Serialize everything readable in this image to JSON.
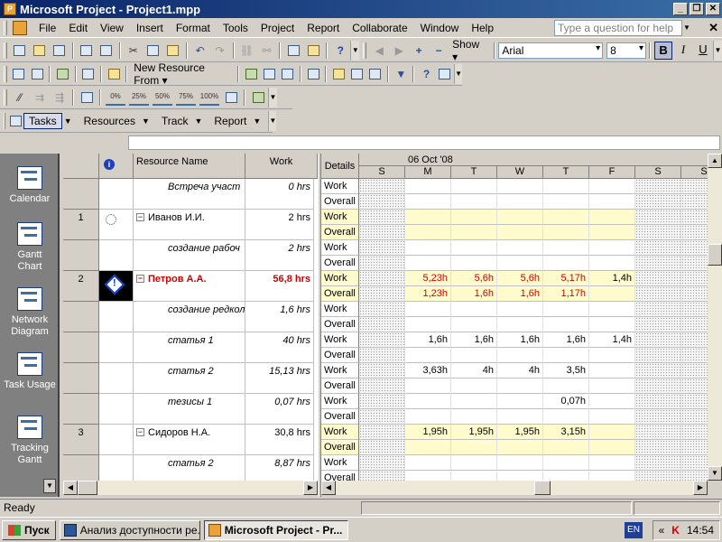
{
  "window": {
    "title": "Microsoft Project - Project1.mpp"
  },
  "menu": {
    "items": [
      "File",
      "Edit",
      "View",
      "Insert",
      "Format",
      "Tools",
      "Project",
      "Report",
      "Collaborate",
      "Window",
      "Help"
    ],
    "help_placeholder": "Type a question for help"
  },
  "toolbar_standard": {
    "show_label": "Show",
    "font": "Arial",
    "font_size": "8",
    "bold": "B",
    "italic": "I",
    "underline": "U"
  },
  "toolbar_resource": {
    "new_resource_from": "New Resource From"
  },
  "toolbar_tracking": {
    "percents": [
      "0%",
      "25%",
      "50%",
      "75%",
      "100%"
    ]
  },
  "toolbar_guide": {
    "tabs": [
      "Tasks",
      "Resources",
      "Track",
      "Report"
    ]
  },
  "viewbar": {
    "items": [
      {
        "label1": "Calendar",
        "label2": ""
      },
      {
        "label1": "Gantt",
        "label2": "Chart"
      },
      {
        "label1": "Network",
        "label2": "Diagram"
      },
      {
        "label1": "Task Usage",
        "label2": ""
      },
      {
        "label1": "Tracking",
        "label2": "Gantt"
      }
    ]
  },
  "grid": {
    "columns": {
      "indicator": "i",
      "name": "Resource Name",
      "work": "Work"
    },
    "rows": [
      {
        "id": "",
        "name": "Встреча участ",
        "work": "0 hrs",
        "type": "assignment"
      },
      {
        "id": "1",
        "name": "Иванов И.И.",
        "work": "2 hrs",
        "type": "resource"
      },
      {
        "id": "",
        "name": "создание рабоч",
        "work": "2 hrs",
        "type": "assignment"
      },
      {
        "id": "2",
        "name": "Петров А.А.",
        "work": "56,8 hrs",
        "type": "overalloc"
      },
      {
        "id": "",
        "name": "создание редкол",
        "work": "1,6 hrs",
        "type": "assignment"
      },
      {
        "id": "",
        "name": "статья 1",
        "work": "40 hrs",
        "type": "assignment"
      },
      {
        "id": "",
        "name": "статья 2",
        "work": "15,13 hrs",
        "type": "assignment"
      },
      {
        "id": "",
        "name": "тезисы 1",
        "work": "0,07 hrs",
        "type": "assignment"
      },
      {
        "id": "3",
        "name": "Сидоров Н.А.",
        "work": "30,8 hrs",
        "type": "resource"
      },
      {
        "id": "",
        "name": "статья 2",
        "work": "8,87 hrs",
        "type": "assignment"
      }
    ]
  },
  "usage": {
    "details_label": "Details",
    "week": "06 Oct '08",
    "days": [
      "S",
      "M",
      "T",
      "W",
      "T",
      "F",
      "S",
      "S"
    ],
    "work_label": "Work",
    "overall_label": "Overall",
    "rows": [
      {
        "work": [
          "",
          "",
          "",
          "",
          "",
          "",
          "",
          ""
        ],
        "overall": [
          "",
          "",
          "",
          "",
          "",
          "",
          "",
          ""
        ],
        "hl": false,
        "red": false
      },
      {
        "work": [
          "",
          "",
          "",
          "",
          "",
          "",
          "",
          ""
        ],
        "overall": [
          "",
          "",
          "",
          "",
          "",
          "",
          "",
          ""
        ],
        "hl": true,
        "red": false
      },
      {
        "work": [
          "",
          "",
          "",
          "",
          "",
          "",
          "",
          ""
        ],
        "overall": [
          "",
          "",
          "",
          "",
          "",
          "",
          "",
          ""
        ],
        "hl": false,
        "red": false
      },
      {
        "work": [
          "",
          "5,23h",
          "5,6h",
          "5,6h",
          "5,17h",
          "1,4h",
          "",
          ""
        ],
        "overall": [
          "",
          "1,23h",
          "1,6h",
          "1,6h",
          "1,17h",
          "",
          "",
          ""
        ],
        "hl": true,
        "red": true
      },
      {
        "work": [
          "",
          "",
          "",
          "",
          "",
          "",
          "",
          ""
        ],
        "overall": [
          "",
          "",
          "",
          "",
          "",
          "",
          "",
          ""
        ],
        "hl": false,
        "red": false
      },
      {
        "work": [
          "",
          "1,6h",
          "1,6h",
          "1,6h",
          "1,6h",
          "1,4h",
          "",
          ""
        ],
        "overall": [
          "",
          "",
          "",
          "",
          "",
          "",
          "",
          ""
        ],
        "hl": false,
        "red": false
      },
      {
        "work": [
          "",
          "3,63h",
          "4h",
          "4h",
          "3,5h",
          "",
          "",
          ""
        ],
        "overall": [
          "",
          "",
          "",
          "",
          "",
          "",
          "",
          ""
        ],
        "hl": false,
        "red": false
      },
      {
        "work": [
          "",
          "",
          "",
          "",
          "0,07h",
          "",
          "",
          ""
        ],
        "overall": [
          "",
          "",
          "",
          "",
          "",
          "",
          "",
          ""
        ],
        "hl": false,
        "red": false
      },
      {
        "work": [
          "",
          "1,95h",
          "1,95h",
          "1,95h",
          "3,15h",
          "",
          "",
          ""
        ],
        "overall": [
          "",
          "",
          "",
          "",
          "",
          "",
          "",
          ""
        ],
        "hl": true,
        "red": false
      },
      {
        "work": [
          "",
          "",
          "",
          "",
          "",
          "",
          "",
          ""
        ],
        "overall": [
          "",
          "",
          "",
          "",
          "",
          "",
          "",
          ""
        ],
        "hl": false,
        "red": false
      }
    ]
  },
  "status": {
    "text": "Ready"
  },
  "taskbar": {
    "start": "Пуск",
    "tasks": [
      "Анализ доступности ре...",
      "Microsoft Project - Pr..."
    ],
    "lang": "EN",
    "time": "14:54"
  }
}
